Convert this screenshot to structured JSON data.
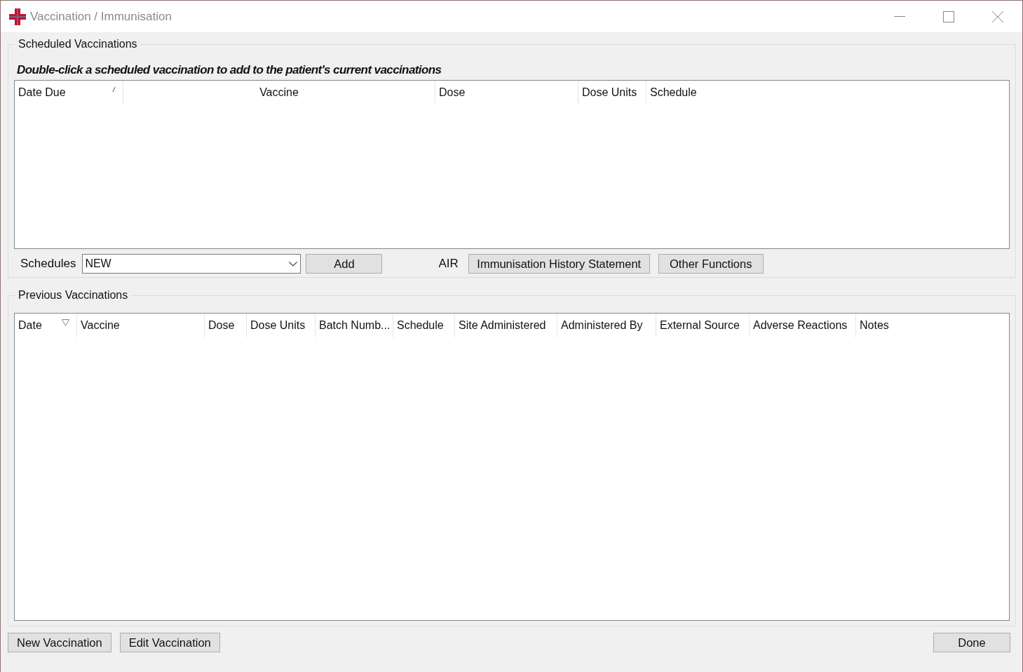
{
  "window": {
    "title": "Vaccination / Immunisation"
  },
  "scheduled": {
    "title": "Scheduled Vaccinations",
    "instruction": "Double-click a scheduled vaccination to add to the patient's current vaccinations",
    "columns": [
      {
        "label": "Date Due",
        "sorted": true,
        "descending": false,
        "centered": false
      },
      {
        "label": "Vaccine",
        "sorted": false,
        "centered": true
      },
      {
        "label": "Dose",
        "sorted": false,
        "centered": false
      },
      {
        "label": "Dose Units",
        "sorted": false,
        "centered": false
      },
      {
        "label": "Schedule",
        "sorted": false,
        "centered": false
      }
    ],
    "schedules_label": "Schedules",
    "schedules_value": "NEW",
    "add_button": "Add",
    "air_label": "AIR",
    "history_button": "Immunisation History Statement",
    "other_button": "Other Functions"
  },
  "previous": {
    "title": "Previous Vaccinations",
    "columns": [
      {
        "label": "Date",
        "sorted": true,
        "descending": true,
        "centered": false
      },
      {
        "label": "Vaccine",
        "sorted": false,
        "centered": false
      },
      {
        "label": "Dose",
        "sorted": false,
        "centered": false
      },
      {
        "label": "Dose Units",
        "sorted": false,
        "centered": false
      },
      {
        "label": "Batch Numb...",
        "sorted": false,
        "centered": false
      },
      {
        "label": "Schedule",
        "sorted": false,
        "centered": false
      },
      {
        "label": "Site Administered",
        "sorted": false,
        "centered": false
      },
      {
        "label": "Administered By",
        "sorted": false,
        "centered": false
      },
      {
        "label": "External Source",
        "sorted": false,
        "centered": false
      },
      {
        "label": "Adverse Reactions",
        "sorted": false,
        "centered": false
      },
      {
        "label": "Notes",
        "sorted": false,
        "centered": false
      }
    ]
  },
  "footer": {
    "new_button": "New Vaccination",
    "edit_button": "Edit Vaccination",
    "done_button": "Done"
  }
}
